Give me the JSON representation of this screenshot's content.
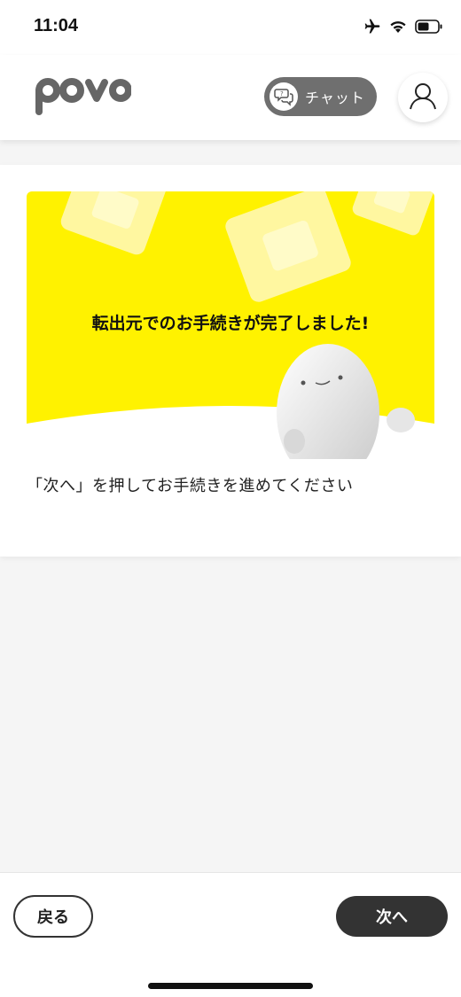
{
  "status_bar": {
    "time": "11:04",
    "icons": [
      "airplane-icon",
      "wifi-icon",
      "battery-icon"
    ]
  },
  "header": {
    "logo_text": "povo",
    "chat_label": "チャット",
    "chat_icon": "chat-bubbles-icon",
    "account_icon": "user-icon"
  },
  "card": {
    "hero_title": "転出元でのお手続きが完了しました!",
    "instruction": "「次へ」を押してお手続きを進めてください"
  },
  "footer": {
    "back_label": "戻る",
    "next_label": "次へ"
  },
  "colors": {
    "brand_yellow": "#fff200",
    "dark_button": "#333333",
    "chat_gray": "#6f6f6f",
    "background": "#f5f5f5"
  }
}
